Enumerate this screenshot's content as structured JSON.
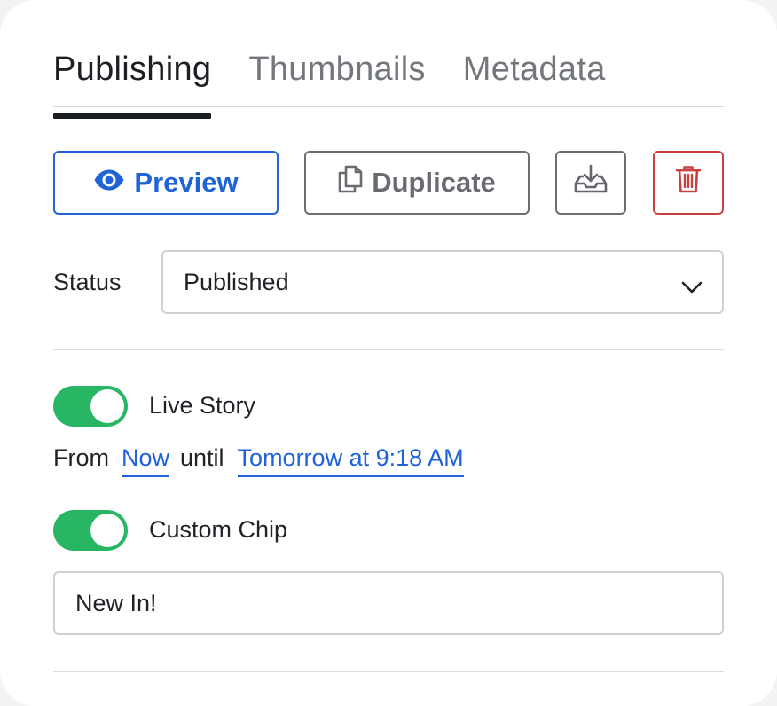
{
  "tabs": [
    {
      "label": "Publishing",
      "active": true
    },
    {
      "label": "Thumbnails",
      "active": false
    },
    {
      "label": "Metadata",
      "active": false
    }
  ],
  "actions": {
    "preview_label": "Preview",
    "duplicate_label": "Duplicate",
    "download_icon": "download-tray-icon",
    "delete_icon": "trash-icon"
  },
  "status": {
    "label": "Status",
    "value": "Published"
  },
  "live_story": {
    "label": "Live Story",
    "enabled": true,
    "from_label": "From",
    "from_value": "Now",
    "until_label": "until",
    "until_value": "Tomorrow at 9:18 AM"
  },
  "custom_chip": {
    "label": "Custom Chip",
    "enabled": true,
    "value": "New In!"
  },
  "colors": {
    "accent_blue": "#1f63d6",
    "toggle_green": "#28b665",
    "danger_red": "#c8403f"
  }
}
